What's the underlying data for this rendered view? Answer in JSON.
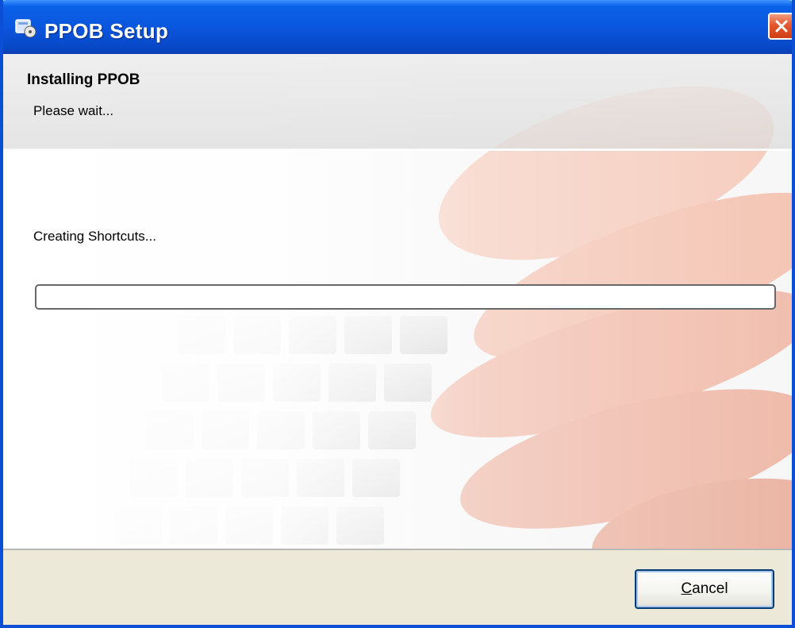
{
  "window": {
    "title": "PPOB Setup",
    "icon": "installer-icon",
    "close_icon": "close-icon"
  },
  "header": {
    "title": "Installing PPOB",
    "subtitle": "Please wait..."
  },
  "main": {
    "status": "Creating Shortcuts...",
    "progress": 0
  },
  "footer": {
    "cancel_first": "C",
    "cancel_rest": "ancel"
  },
  "colors": {
    "titlebar": "#0a56de",
    "close": "#e4572f",
    "panel": "#ece9d8"
  }
}
